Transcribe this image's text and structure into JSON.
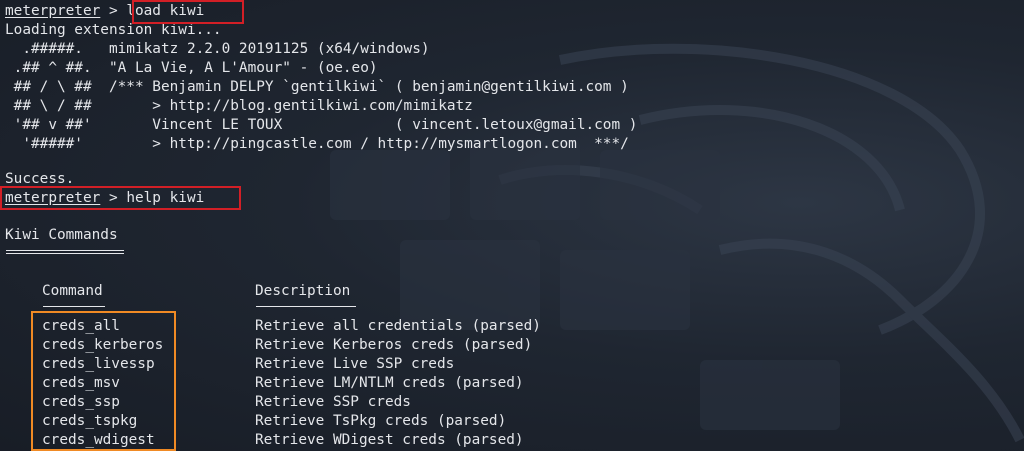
{
  "prompt": "meterpreter",
  "cmd1": "load kiwi",
  "loading": "Loading extension kiwi...",
  "banner": [
    "  .#####.   mimikatz 2.2.0 20191125 (x64/windows)",
    " .## ^ ##.  \"A La Vie, A L'Amour\" - (oe.eo)",
    " ## / \\ ##  /*** Benjamin DELPY `gentilkiwi` ( benjamin@gentilkiwi.com )",
    " ## \\ / ##       > http://blog.gentilkiwi.com/mimikatz",
    " '## v ##'       Vincent LE TOUX             ( vincent.letoux@gmail.com )",
    "  '#####'        > http://pingcastle.com / http://mysmartlogon.com  ***/"
  ],
  "success": "Success.",
  "cmd2": "help kiwi",
  "section_title": "Kiwi Commands",
  "col_command": "Command",
  "col_description": "Description",
  "commands": [
    {
      "name": "creds_all",
      "desc": "Retrieve all credentials (parsed)"
    },
    {
      "name": "creds_kerberos",
      "desc": "Retrieve Kerberos creds (parsed)"
    },
    {
      "name": "creds_livessp",
      "desc": "Retrieve Live SSP creds"
    },
    {
      "name": "creds_msv",
      "desc": "Retrieve LM/NTLM creds (parsed)"
    },
    {
      "name": "creds_ssp",
      "desc": "Retrieve SSP creds"
    },
    {
      "name": "creds_tspkg",
      "desc": "Retrieve TsPkg creds (parsed)"
    },
    {
      "name": "creds_wdigest",
      "desc": "Retrieve WDigest creds (parsed)"
    }
  ],
  "highlight_colors": {
    "red": "#d21f26",
    "orange": "#f08a24"
  }
}
